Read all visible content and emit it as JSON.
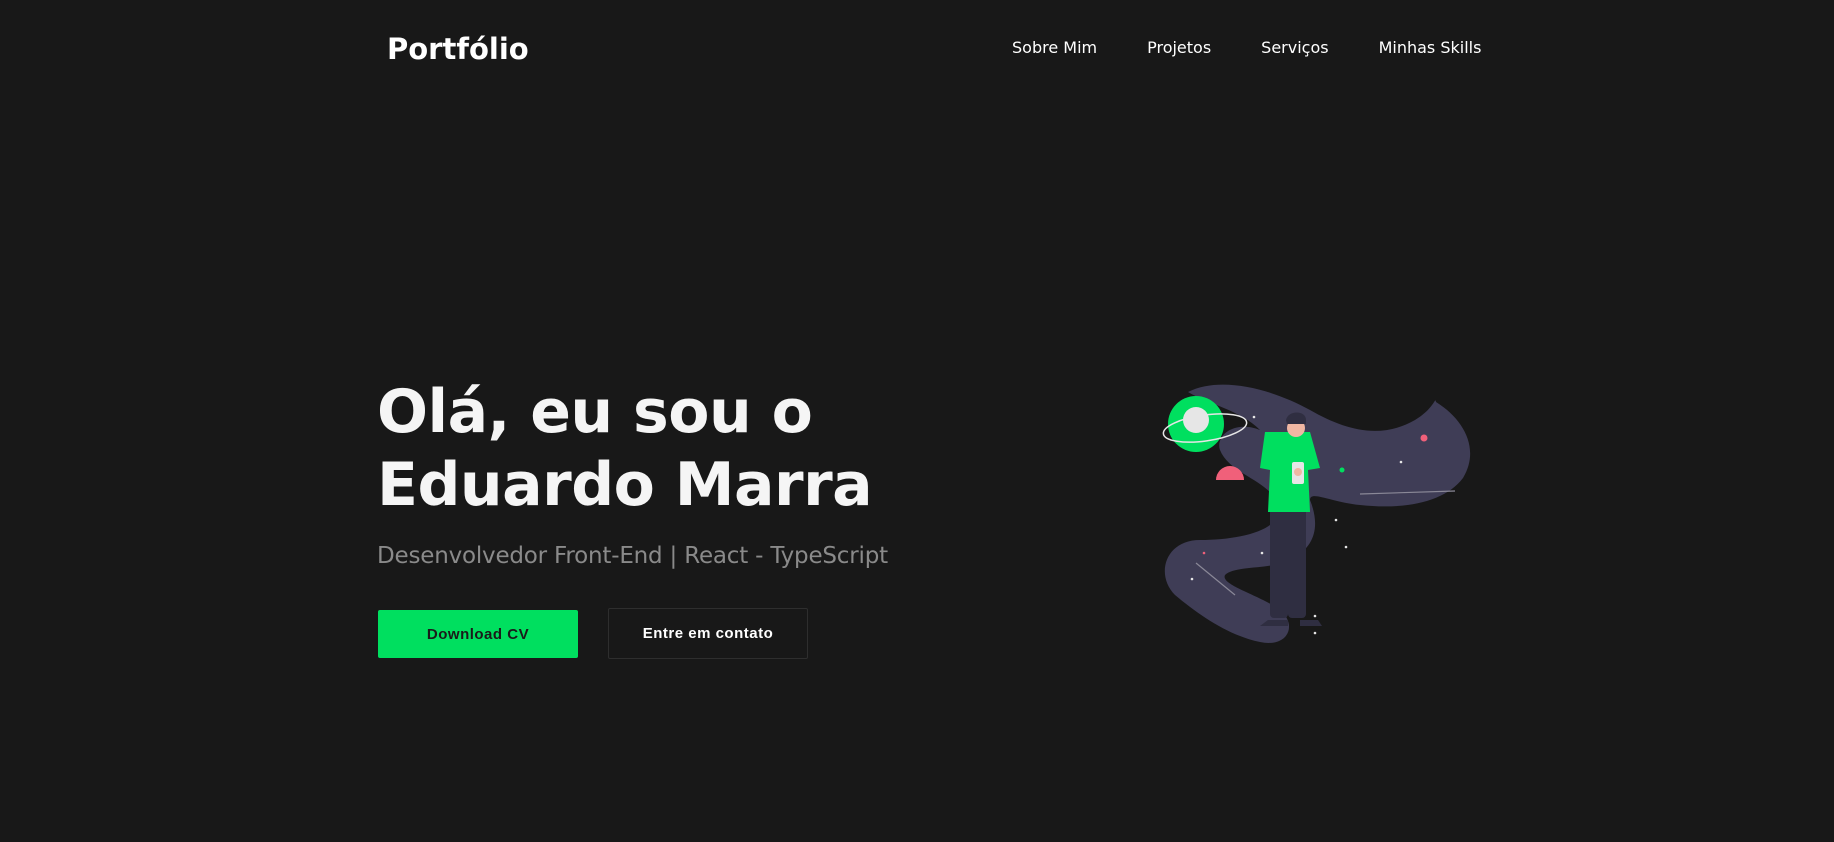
{
  "header": {
    "logo": "Portfólio",
    "nav": [
      {
        "label": "Sobre Mim"
      },
      {
        "label": "Projetos"
      },
      {
        "label": "Serviços"
      },
      {
        "label": "Minhas Skills"
      }
    ]
  },
  "hero": {
    "title_line1": "Olá, eu sou o",
    "title_line2": "Eduardo Marra",
    "subtitle": "Desenvolvedor Front-End | React - TypeScript",
    "primary_button": "Download CV",
    "secondary_button": "Entre em contato"
  },
  "colors": {
    "background": "#181818",
    "accent": "#00df5f",
    "planet_pink": "#f0607a",
    "space_purple": "#3f3d56"
  }
}
